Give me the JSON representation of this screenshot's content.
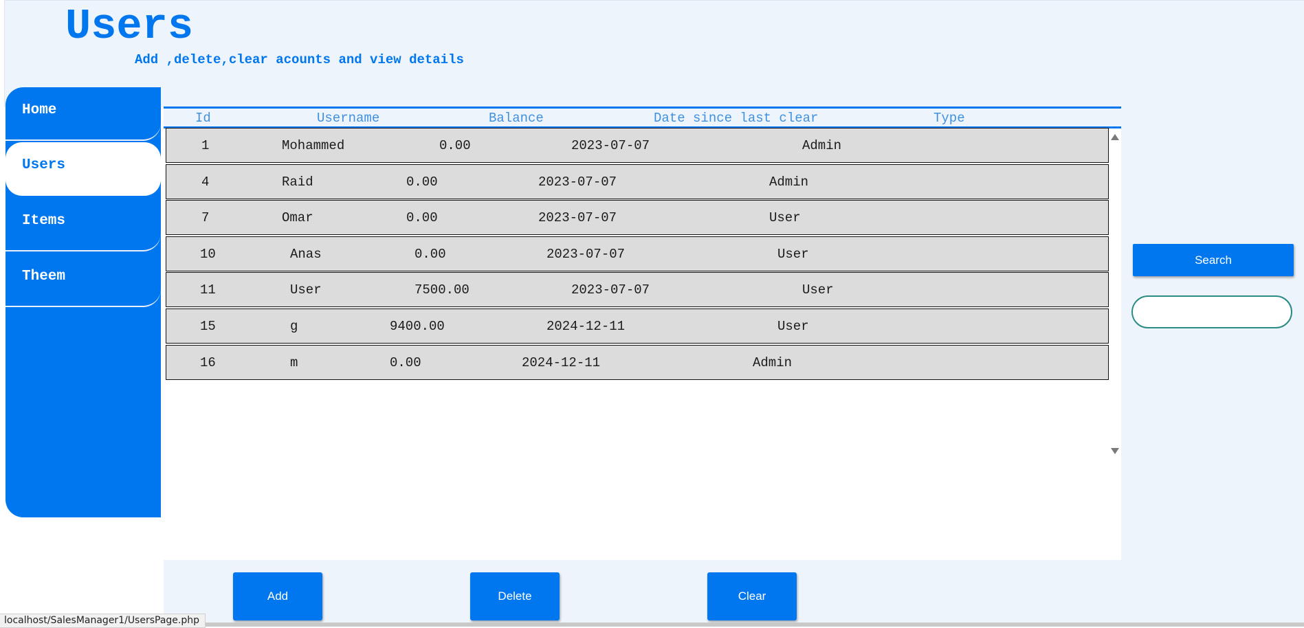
{
  "header": {
    "title": "Users",
    "subtitle": "Add ,delete,clear acounts and view details"
  },
  "sidebar": {
    "items": [
      {
        "label": "Home",
        "active": false
      },
      {
        "label": "Users",
        "active": true
      },
      {
        "label": "Items",
        "active": false
      },
      {
        "label": "Theem",
        "active": false
      }
    ]
  },
  "table": {
    "columns": [
      "Id",
      "Username",
      "Balance",
      "Date since last clear",
      "Type"
    ],
    "rows": [
      {
        "id": "1",
        "username": "Mohammed",
        "balance": "0.00",
        "date": "2023-07-07",
        "type": "Admin"
      },
      {
        "id": "4",
        "username": "Raid",
        "balance": "0.00",
        "date": "2023-07-07",
        "type": "Admin"
      },
      {
        "id": "7",
        "username": "Omar",
        "balance": "0.00",
        "date": "2023-07-07",
        "type": "User"
      },
      {
        "id": "10",
        "username": "Anas",
        "balance": "0.00",
        "date": "2023-07-07",
        "type": "User"
      },
      {
        "id": "11",
        "username": "User",
        "balance": "7500.00",
        "date": "2023-07-07",
        "type": "User"
      },
      {
        "id": "15",
        "username": "g",
        "balance": "9400.00",
        "date": "2024-12-11",
        "type": "User"
      },
      {
        "id": "16",
        "username": "m",
        "balance": "0.00",
        "date": "2024-12-11",
        "type": "Admin"
      }
    ]
  },
  "actions": {
    "add_label": "Add",
    "delete_label": "Delete",
    "clear_label": "Clear"
  },
  "search": {
    "button_label": "Search",
    "value": ""
  },
  "status_bar": {
    "url": "localhost/SalesManager1/UsersPage.php"
  },
  "colors": {
    "accent": "#0077ee",
    "header_bg": "#eef4fb",
    "row_bg": "#dcdcdc",
    "search_border": "#2a8a84"
  },
  "icons": {
    "scroll_up": "triangle-up-icon",
    "scroll_down": "triangle-down-icon"
  }
}
